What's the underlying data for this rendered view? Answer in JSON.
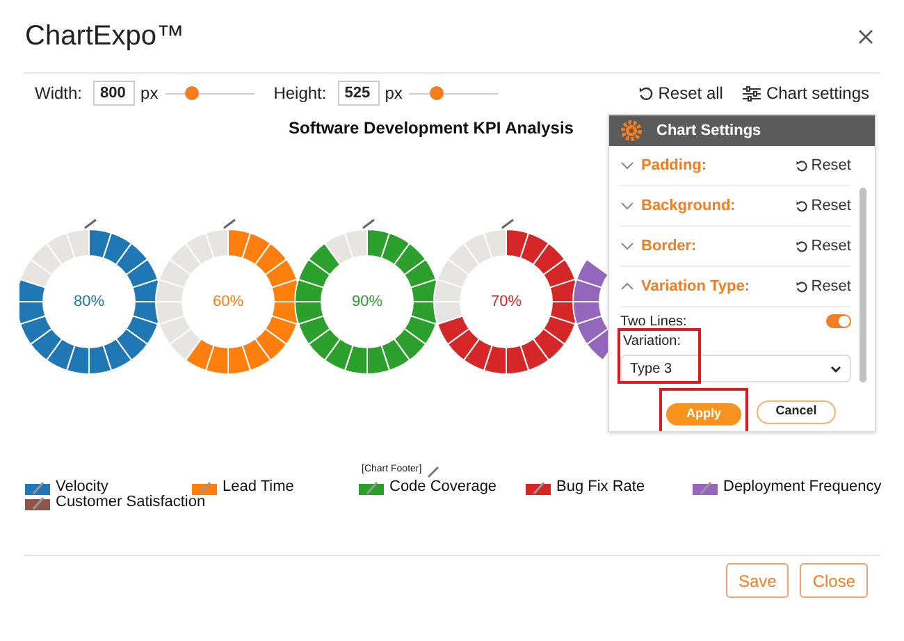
{
  "window": {
    "title": "ChartExpo™"
  },
  "toolbar": {
    "width_label": "Width:",
    "width_value": "800",
    "width_unit": "px",
    "width_slider": {
      "level": 0.3
    },
    "height_label": "Height:",
    "height_value": "525",
    "height_unit": "px",
    "height_slider": {
      "level": 0.3
    },
    "reset_all": "Reset all",
    "chart_settings": "Chart settings"
  },
  "chart": {
    "title": "Software Development KPI Analysis",
    "footer": "[Chart Footer]",
    "gauges": [
      {
        "kind": "gauge",
        "label": "80%",
        "level": 0.8,
        "color": "#1f77b4"
      },
      {
        "kind": "gauge",
        "label": "60%",
        "level": 0.6,
        "color": "#ff7f0e"
      },
      {
        "kind": "gauge",
        "label": "90%",
        "level": 0.9,
        "color": "#2ca02c"
      },
      {
        "kind": "gauge",
        "label": "70%",
        "level": 0.7,
        "color": "#d62728"
      },
      {
        "kind": "clipped",
        "color": "#9467bd"
      }
    ],
    "legend": [
      {
        "label": "Velocity",
        "color": "#1f77b4"
      },
      {
        "label": "Lead Time",
        "color": "#ff7f0e"
      },
      {
        "label": "Code Coverage",
        "color": "#2ca02c"
      },
      {
        "label": "Bug Fix Rate",
        "color": "#d62728"
      },
      {
        "label": "Deployment Frequency",
        "color": "#9467bd"
      },
      {
        "label": "Customer Satisfaction",
        "color": "#8c564b"
      }
    ]
  },
  "settings_panel": {
    "title": "Chart Settings",
    "sections": [
      {
        "label": "Padding:",
        "reset": "Reset",
        "expanded": false
      },
      {
        "label": "Background:",
        "reset": "Reset",
        "expanded": false
      },
      {
        "label": "Border:",
        "reset": "Reset",
        "expanded": false
      },
      {
        "label": "Variation Type:",
        "reset": "Reset",
        "expanded": true
      }
    ],
    "two_lines": {
      "label": "Two Lines:",
      "on": true
    },
    "variation": {
      "label": "Variation:",
      "value": "Type 3",
      "highlighted": true
    },
    "apply": {
      "label": "Apply",
      "highlighted": true
    },
    "cancel": {
      "label": "Cancel"
    }
  },
  "footer_buttons": [
    "Save",
    "Close"
  ]
}
